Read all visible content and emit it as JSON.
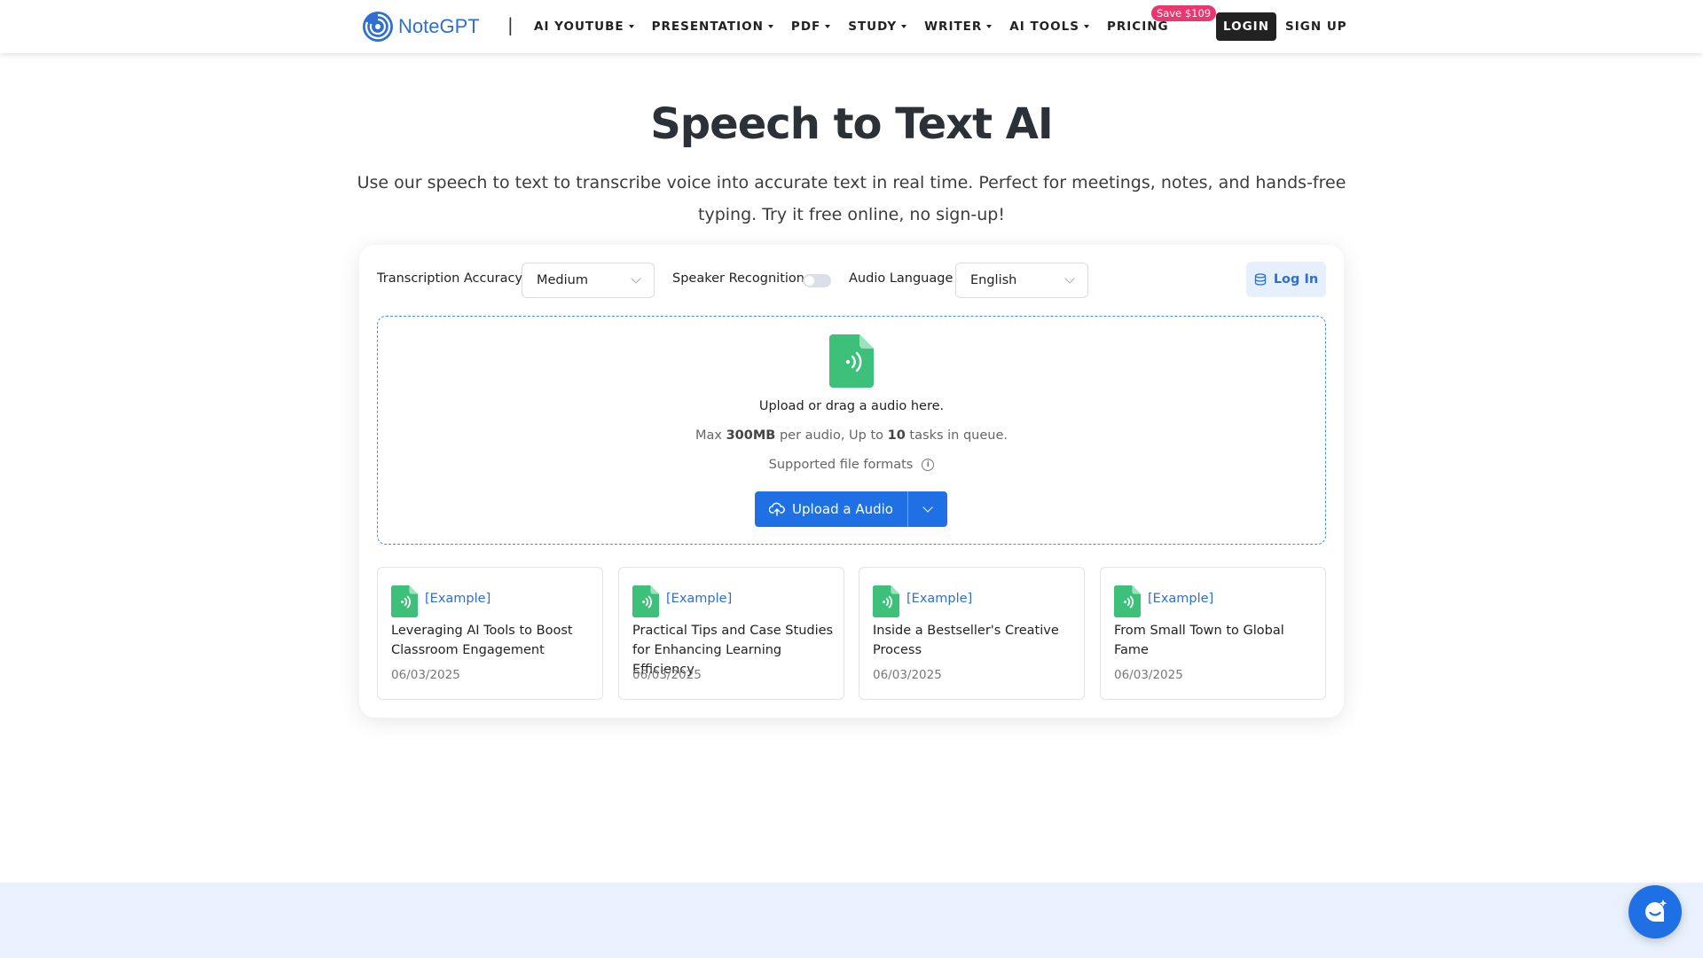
{
  "brand": {
    "name": "NoteGPT",
    "accent": "#1f6fe5"
  },
  "nav": {
    "separator": "|",
    "items": [
      {
        "label": "AI YOUTUBE"
      },
      {
        "label": "PRESENTATION"
      },
      {
        "label": "PDF"
      },
      {
        "label": "STUDY"
      },
      {
        "label": "WRITER"
      },
      {
        "label": "AI TOOLS"
      }
    ],
    "pricing": {
      "label": "PRICING",
      "badge": "Save $109"
    },
    "login": "LOGIN",
    "signup": "SIGN UP"
  },
  "hero": {
    "title": "Speech to Text AI",
    "subtitle": "Use our speech to text to transcribe voice into accurate text in real time. Perfect for meetings, notes, and hands-free typing. Try it free online, no sign-up!"
  },
  "options": {
    "accuracy_label": "Transcription Accuracy",
    "accuracy_value": "Medium",
    "speaker_label": "Speaker Recognition",
    "speaker_enabled": false,
    "language_label": "Audio Language",
    "language_value": "English",
    "login_label": "Log In"
  },
  "upload": {
    "main": "Upload or drag a audio here.",
    "info_prefix": "Max ",
    "max_size": "300MB",
    "info_mid": " per audio, Up to ",
    "max_tasks": "10",
    "info_suffix": " tasks in queue.",
    "formats": "Supported file formats",
    "button": "Upload a Audio"
  },
  "examples": [
    {
      "tag": "[Example]",
      "title": "Leveraging AI Tools to Boost Classroom Engagement",
      "date": "06/03/2025"
    },
    {
      "tag": "[Example]",
      "title": "Practical Tips and Case Studies for Enhancing Learning Efficiency",
      "date": "06/03/2025"
    },
    {
      "tag": "[Example]",
      "title": "Inside a Bestseller's Creative Process",
      "date": "06/03/2025"
    },
    {
      "tag": "[Example]",
      "title": "From Small Town to Global Fame",
      "date": "06/03/2025"
    }
  ],
  "icons": {
    "logo": "swirl-logo-icon",
    "audio_file": "audio-file-icon",
    "upload": "cloud-upload-icon",
    "info": "info-icon",
    "chat": "chat-assistant-icon",
    "database": "database-icon"
  }
}
